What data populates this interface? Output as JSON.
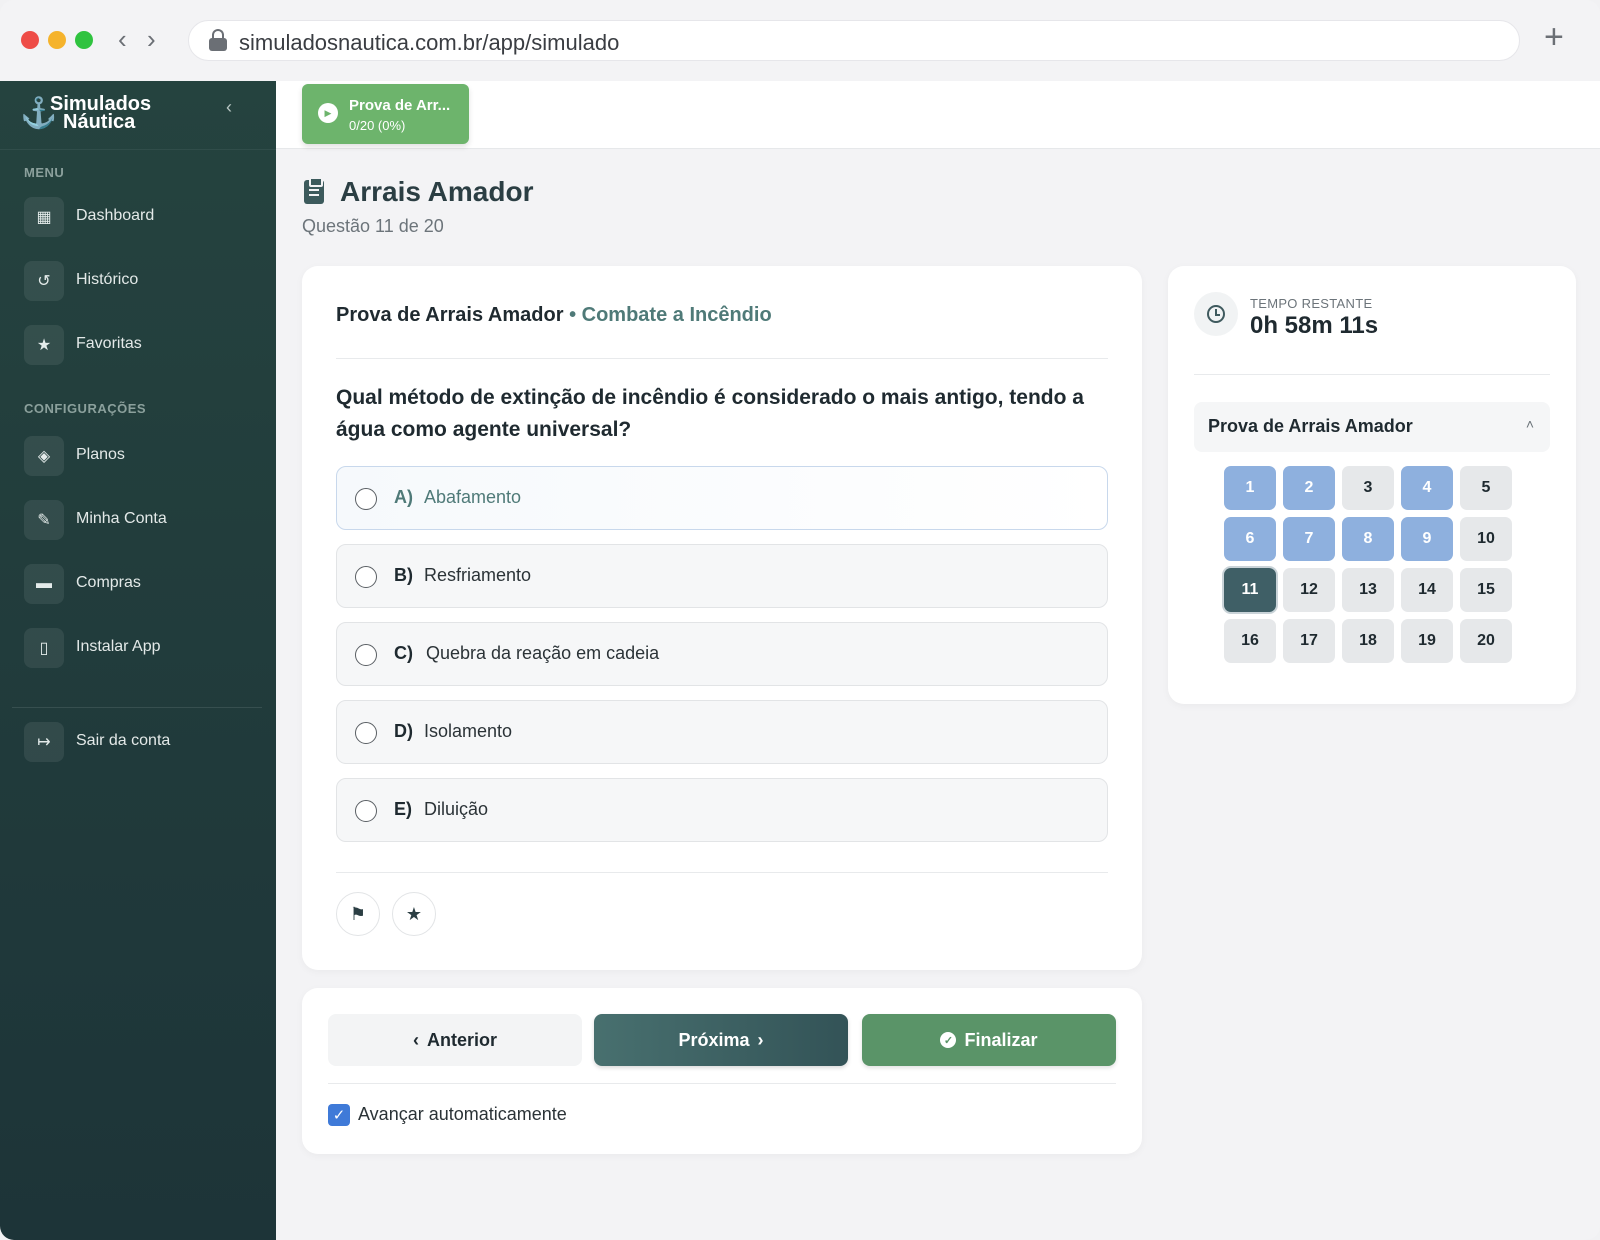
{
  "browser": {
    "url": "simuladosnautica.com.br/app/simulado",
    "back_icon": "‹",
    "forward_icon": "›",
    "new_tab_icon": "+"
  },
  "sidebar": {
    "brand_line1": "Simulados",
    "brand_line2": "Náutica",
    "collapse_icon": "‹",
    "menu_label": "MENU",
    "settings_label": "CONFIGURAÇÕES",
    "items": [
      {
        "label": "Dashboard",
        "icon": "grid-icon",
        "glyph": "▦"
      },
      {
        "label": "Histórico",
        "icon": "history-icon",
        "glyph": "↺"
      },
      {
        "label": "Favoritas",
        "icon": "star-icon",
        "glyph": "★"
      },
      {
        "label": "Planos",
        "icon": "tag-icon",
        "glyph": "◈"
      },
      {
        "label": "Minha Conta",
        "icon": "user-edit-icon",
        "glyph": "✎"
      },
      {
        "label": "Compras",
        "icon": "card-icon",
        "glyph": "▬"
      },
      {
        "label": "Instalar App",
        "icon": "mobile-icon",
        "glyph": "▯"
      },
      {
        "label": "Sair da conta",
        "icon": "logout-icon",
        "glyph": "↦"
      }
    ]
  },
  "topbar": {
    "pill_title": "Prova de Arr...",
    "pill_progress": "0/20 (0%)",
    "play_icon": "▶"
  },
  "page": {
    "title": "Arrais Amador",
    "subtitle": "Questão 11 de 20"
  },
  "question": {
    "exam": "Prova de Arrais Amador",
    "bullet": "•",
    "topic": "Combate a Incêndio",
    "text": "Qual método de extinção de incêndio é considerado o mais antigo, tendo a água como agente universal?",
    "options": [
      {
        "letter": "A)",
        "text": "Abafamento"
      },
      {
        "letter": "B)",
        "text": "Resfriamento"
      },
      {
        "letter": "C)",
        "text": "Quebra da reação em cadeia"
      },
      {
        "letter": "D)",
        "text": "Isolamento"
      },
      {
        "letter": "E)",
        "text": "Diluição"
      }
    ],
    "flag_icon": "⚑",
    "star_icon": "★"
  },
  "navigation": {
    "prev_label": "Anterior",
    "prev_icon": "‹",
    "next_label": "Próxima",
    "next_icon": "›",
    "finish_label": "Finalizar",
    "finish_icon": "✓",
    "auto_label": "Avançar automaticamente",
    "auto_checked": "✓"
  },
  "timer": {
    "label": "TEMPO RESTANTE",
    "value": "0h 58m 11s"
  },
  "question_map": {
    "title": "Prova de Arrais Amador",
    "chevron": "˄",
    "questions": [
      "1",
      "2",
      "3",
      "4",
      "5",
      "6",
      "7",
      "8",
      "9",
      "10",
      "11",
      "12",
      "13",
      "14",
      "15",
      "16",
      "17",
      "18",
      "19",
      "20"
    ],
    "answered": [
      1,
      2,
      4,
      6,
      7,
      8,
      9
    ],
    "current": 11
  }
}
